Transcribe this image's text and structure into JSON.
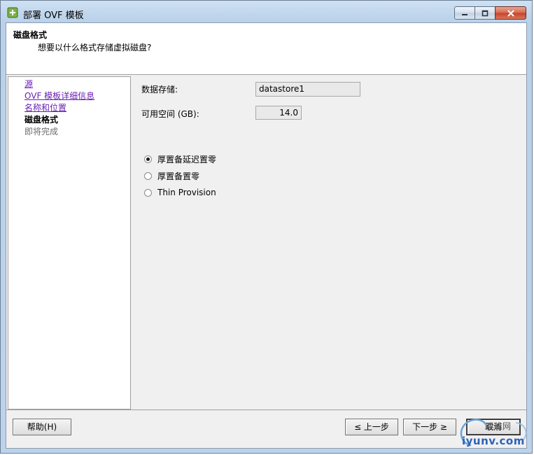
{
  "window": {
    "title": "部署 OVF 模板"
  },
  "header": {
    "title": "磁盘格式",
    "subtitle": "想要以什么格式存储虚拟磁盘?"
  },
  "nav": {
    "items": [
      {
        "label": "源",
        "state": "link"
      },
      {
        "label": "OVF 模板详细信息",
        "state": "link"
      },
      {
        "label": "名称和位置",
        "state": "link"
      },
      {
        "label": "磁盘格式",
        "state": "current"
      },
      {
        "label": "即将完成",
        "state": "pending"
      }
    ]
  },
  "form": {
    "datastore_label": "数据存储:",
    "datastore_value": "datastore1",
    "free_space_label": "可用空间 (GB):",
    "free_space_value": "14.0",
    "options": [
      {
        "label": "厚置备延迟置零",
        "selected": true
      },
      {
        "label": "厚置备置零",
        "selected": false
      },
      {
        "label": "Thin Provision",
        "selected": false
      }
    ]
  },
  "buttons": {
    "help": "帮助(H)",
    "back": "≤ 上一步",
    "next": "下一步 ≥",
    "cancel": "取消"
  },
  "watermark": {
    "text": "iyunv.com",
    "cn": "运维网"
  },
  "colors": {
    "link": "#6a1fb3",
    "titlebar": "#b9d1ea",
    "close_button": "#c7412a"
  }
}
